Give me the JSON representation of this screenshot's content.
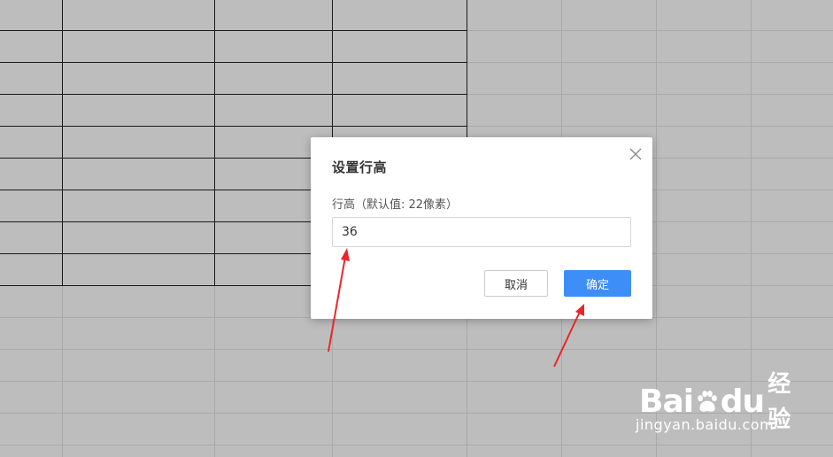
{
  "dialog": {
    "title": "设置行高",
    "field_label": "行高（默认值: 22像素）",
    "input_value": "36",
    "cancel_label": "取消",
    "ok_label": "确定",
    "close_icon": "close-icon"
  },
  "watermark": {
    "brand_left": "Bai",
    "brand_right": "du",
    "product": "经验",
    "url": "jingyan.baidu.com"
  },
  "colors": {
    "sheet_background": "#bdbdbd",
    "primary_button": "#3d8ef7",
    "annotation_arrow": "#e8262b"
  }
}
